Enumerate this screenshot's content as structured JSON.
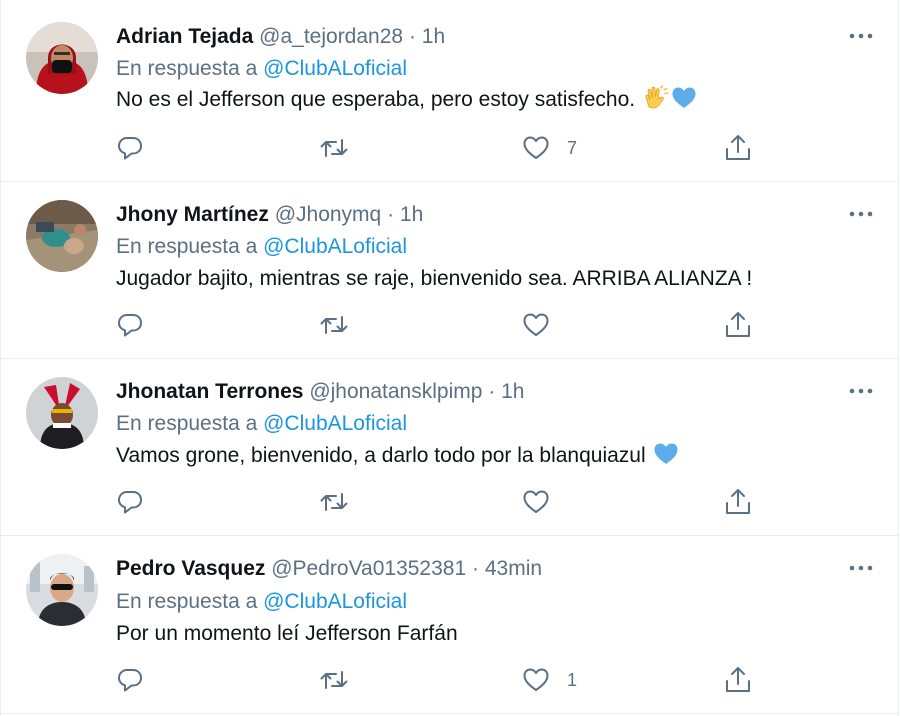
{
  "reply_prefix": "En respuesta a",
  "tweets": [
    {
      "name": "Adrian Tejada",
      "handle": "@a_tejordan28",
      "separator": "·",
      "time": "1h",
      "mention": "@ClubALoficial",
      "text": "No es el Jefferson que esperaba, pero estoy satisfecho.",
      "emojis": [
        "clapping-hands",
        "blue-heart"
      ],
      "likes": "7"
    },
    {
      "name": "Jhony Martínez",
      "handle": "@Jhonymq",
      "separator": "·",
      "time": "1h",
      "mention": "@ClubALoficial",
      "text": "Jugador bajito, mientras se raje, bienvenido sea. ARRIBA ALIANZA !",
      "emojis": [],
      "likes": ""
    },
    {
      "name": "Jhonatan Terrones",
      "handle": "@jhonatansklpimp",
      "separator": "·",
      "time": "1h",
      "mention": "@ClubALoficial",
      "text": "Vamos grone, bienvenido, a darlo todo por la blanquiazul",
      "emojis": [
        "blue-heart"
      ],
      "likes": ""
    },
    {
      "name": "Pedro Vasquez",
      "handle": "@PedroVa01352381",
      "separator": "·",
      "time": "43min",
      "mention": "@ClubALoficial",
      "text": "Por un momento leí Jefferson Farfán",
      "emojis": [],
      "likes": "1"
    }
  ],
  "colors": {
    "text": "#0f1419",
    "secondary": "#5b7083",
    "link": "#1b95e0",
    "divider": "#ebeef0",
    "heart_emoji": "#5dadec",
    "clap_emoji": "#ffcc4d"
  },
  "icons": {
    "more": "more-horizontal-icon",
    "reply": "reply-icon",
    "retweet": "retweet-icon",
    "like": "like-icon",
    "share": "share-icon"
  }
}
